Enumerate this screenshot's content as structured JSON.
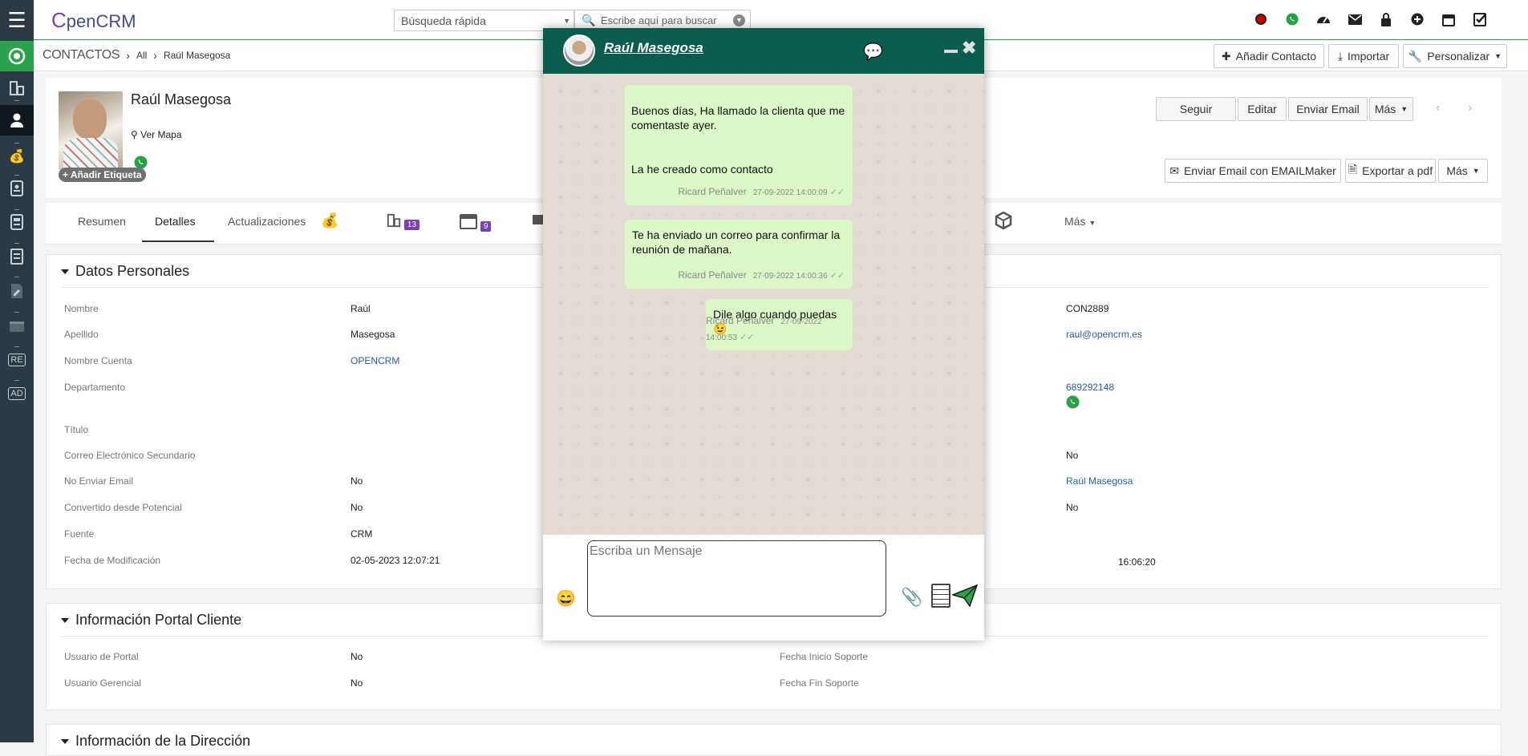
{
  "app": {
    "logo_c": "C",
    "logo_rest": "penCRM"
  },
  "search": {
    "select": "Búsqueda rápida",
    "placeholder": "Escribe aquí para buscar"
  },
  "breadcrumb": {
    "module": "CONTACTOS",
    "filter": "All",
    "record": "Raúl Masegosa"
  },
  "actions": {
    "add_contact": "Añadir Contacto",
    "import": "Importar",
    "customize": "Personalizar"
  },
  "contact": {
    "name": "Raúl Masegosa",
    "map": "Ver Mapa",
    "tag": "+ Añadir Etiqueta"
  },
  "header_buttons": {
    "follow": "Seguir",
    "edit": "Editar",
    "send_email": "Enviar Email",
    "more": "Más",
    "email_maker": "Enviar Email con EMAILMaker",
    "pdf": "Exportar a pdf",
    "more2": "Más"
  },
  "tabs": {
    "summary": "Resumen",
    "details": "Detalles",
    "updates": "Actualizaciones",
    "badge1": "13",
    "badge2": "9",
    "more": "Más"
  },
  "sidebar": {
    "re": "RE",
    "ad": "AD"
  },
  "personal": {
    "title": "Datos Personales",
    "left": [
      {
        "label": "Nombre",
        "value": "Raúl"
      },
      {
        "label": "Apellido",
        "value": "Masegosa"
      },
      {
        "label": "Nombre Cuenta",
        "value": "OPENCRM"
      },
      {
        "label": "Departamento",
        "value": ""
      },
      {
        "label": "Título",
        "value": ""
      },
      {
        "label": "Correo Electrónico Secundario",
        "value": ""
      },
      {
        "label": "No Enviar Email",
        "value": "No"
      },
      {
        "label": "Convertido desde Potencial",
        "value": "No"
      },
      {
        "label": "Fuente",
        "value": "CRM"
      },
      {
        "label": "Fecha de Modificación",
        "value": "02-05-2023 12:07:21"
      }
    ],
    "right": {
      "code": "CON2889",
      "email": "raul@opencrm.es",
      "phone": "689292148",
      "val_no1": "No",
      "owner": "Raúl Masegosa",
      "val_no2": "No",
      "time": "16:06:20"
    }
  },
  "portal": {
    "title": "Información Portal Cliente",
    "rows": [
      {
        "label": "Usuario de Portal",
        "value": "No",
        "label2": "Fecha Inicio Soporte"
      },
      {
        "label": "Usuario Gerencial",
        "value": "No",
        "label2": "Fecha Fin Soporte"
      }
    ]
  },
  "address": {
    "title": "Información de la Dirección"
  },
  "chat": {
    "name": "Raúl Masegosa",
    "messages": [
      {
        "line1": "Buenos días, Ha llamado la clienta que me",
        "line2": "comentaste ayer.",
        "line3": "La he creado como contacto",
        "author": "Ricard Peñalver",
        "date": "27-09-2022 14:00:09"
      },
      {
        "line1": "Te ha enviado un correo para confirmar la",
        "line2": "reunión de mañana.",
        "author": "Ricard Peñalver",
        "date": "27-09-2022 14:00:36"
      },
      {
        "line1": "Dile algo cuando puedas 😉",
        "author": "Ricard Peñalver",
        "date": "27-09-2022 14:00:53"
      }
    ],
    "placeholder": "Escriba un Mensaje"
  },
  "colors": {
    "accent": "#2ba24c",
    "chat_header": "#0a5c4c",
    "bubble": "#dcf8c6",
    "sidebar": "#2b3a44",
    "badge": "#7b3fb8"
  }
}
